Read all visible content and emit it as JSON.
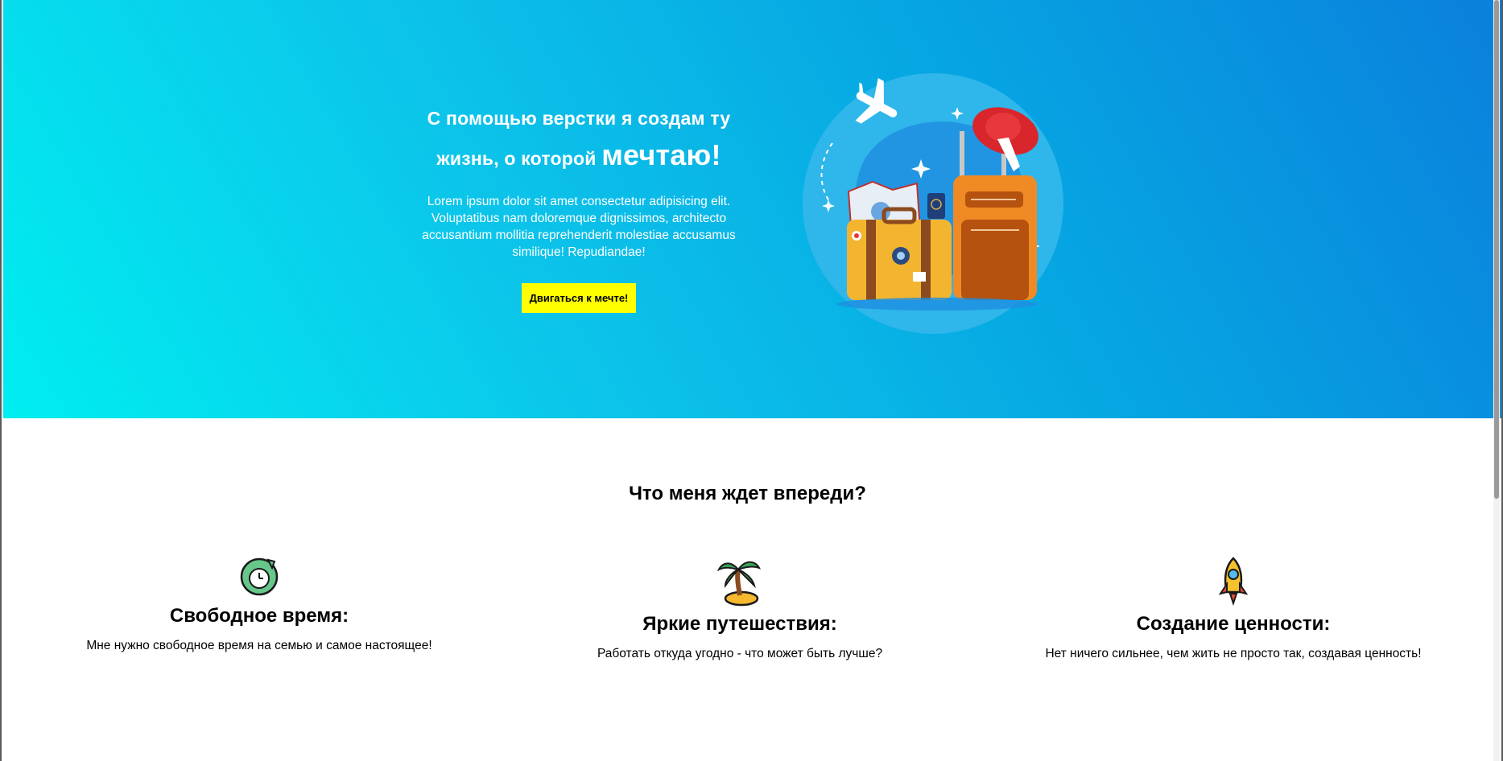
{
  "hero": {
    "title_line1": "С помощью верстки я создам ту",
    "title_line2": "жизнь, о которой",
    "title_emphasis": "мечтаю!",
    "description": "Lorem ipsum dolor sit amet consectetur adipisicing elit. Voluptatibus nam doloremque dignissimos, architecto accusantium mollitia reprehenderit molestiae accusamus similique! Repudiandae!",
    "cta_label": "Двигаться к мечте!",
    "illustration_icon": "travel-suitcases-illustration",
    "gradient_colors": [
      "#00eef0",
      "#0a80dc"
    ],
    "cta_color": "#ffff00"
  },
  "features": {
    "title": "Что меня ждет впереди?",
    "items": [
      {
        "icon": "clock-refresh-icon",
        "title": "Свободное время:",
        "text": "Мне нужно свободное время на семью и самое настоящее!"
      },
      {
        "icon": "palm-island-icon",
        "title": "Яркие путешествия:",
        "text": "Работать откуда угодно - что может быть лучше?"
      },
      {
        "icon": "rocket-icon",
        "title": "Создание ценности:",
        "text": "Нет ничего сильнее, чем жить не просто так, создавая ценность!"
      }
    ]
  }
}
